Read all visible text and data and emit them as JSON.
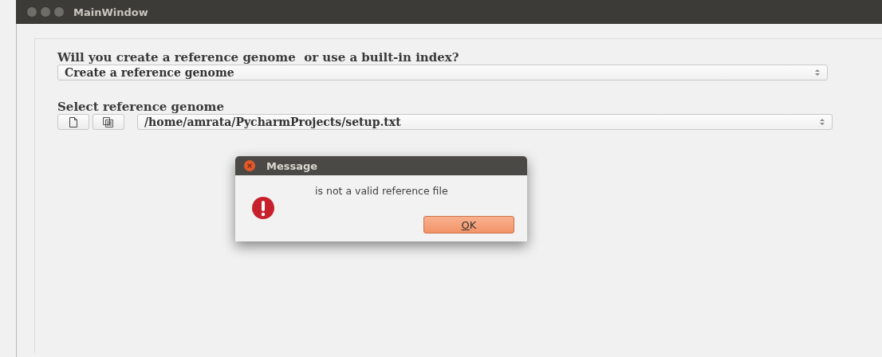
{
  "window": {
    "title": "MainWindow"
  },
  "question": {
    "label": "Will you create a reference genome  or use a built-in index?",
    "value": "Create a reference genome"
  },
  "reference": {
    "label": "Select reference genome",
    "value": "/home/amrata/PycharmProjects/setup.txt"
  },
  "dialog": {
    "title": "Message",
    "message": "is not a valid reference file",
    "buttons": [
      "OK"
    ]
  }
}
